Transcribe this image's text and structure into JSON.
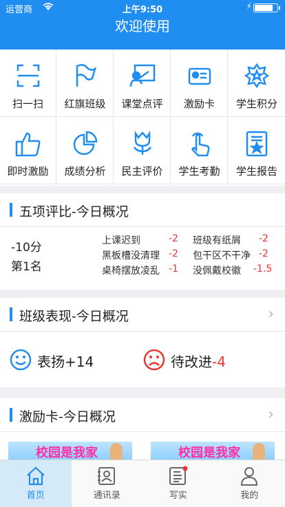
{
  "status": {
    "carrier": "运营商",
    "time": "上午9:50"
  },
  "navbar": {
    "title": "欢迎使用"
  },
  "grid": [
    {
      "label": "扫一扫",
      "icon": "scan-icon"
    },
    {
      "label": "红旗班级",
      "icon": "flag-icon"
    },
    {
      "label": "课堂点评",
      "icon": "teacher-board-icon"
    },
    {
      "label": "激励卡",
      "icon": "id-card-icon"
    },
    {
      "label": "学生积分",
      "icon": "star-badge-icon"
    },
    {
      "label": "即时激励",
      "icon": "thumbs-up-icon"
    },
    {
      "label": "成绩分析",
      "icon": "pie-chart-icon"
    },
    {
      "label": "民主评价",
      "icon": "tulip-icon"
    },
    {
      "label": "学生考勤",
      "icon": "finger-tap-icon"
    },
    {
      "label": "学生报告",
      "icon": "report-icon"
    }
  ],
  "five_items": {
    "title": "五项评比-今日概况",
    "score": "-10分",
    "rank": "第1名",
    "items": [
      {
        "name": "上课迟到",
        "value": "-2"
      },
      {
        "name": "班级有纸屑",
        "value": "-2"
      },
      {
        "name": "黑板槽没清理",
        "value": "-2"
      },
      {
        "name": "包干区不干净",
        "value": "-2"
      },
      {
        "name": "桌椅摆放凌乱",
        "value": "-1"
      },
      {
        "name": "没佩戴校徽",
        "value": "-1.5"
      }
    ]
  },
  "class_perf": {
    "title": "班级表现-今日概况",
    "praise_label": "表扬",
    "praise_value": "+14",
    "improve_label": "待改进",
    "improve_value": "-4"
  },
  "incentive": {
    "title": "激励卡-今日概况",
    "banner_text": "校园是我家"
  },
  "tabbar": [
    {
      "label": "首页",
      "icon": "home-icon",
      "active": true
    },
    {
      "label": "通讯录",
      "icon": "contacts-icon",
      "active": false
    },
    {
      "label": "写实",
      "icon": "write-icon",
      "active": false
    },
    {
      "label": "我的",
      "icon": "profile-icon",
      "active": false
    }
  ],
  "colors": {
    "accent": "#1f8ef0",
    "negative": "#e33333"
  }
}
